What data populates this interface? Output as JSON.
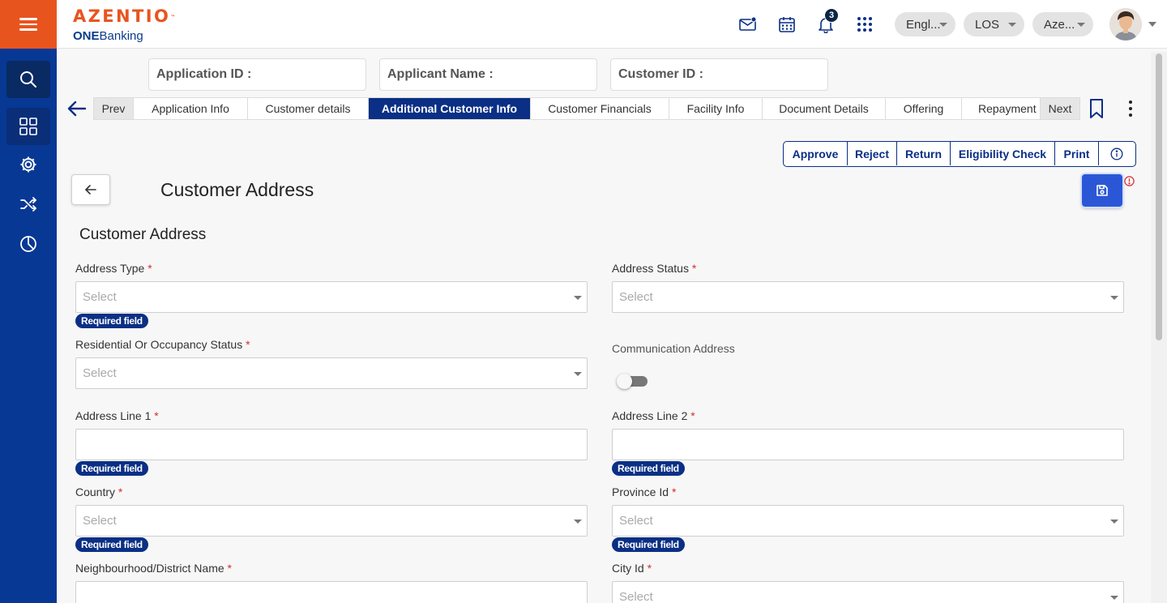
{
  "header": {
    "brand": "AZENTIO",
    "brand_tm": "™",
    "product_bold": "ONE",
    "product_rest": "Banking",
    "notification_count": "3",
    "language": "Engl...",
    "module": "LOS",
    "entity": "Aze...",
    "icons": [
      "mail-icon",
      "calendar-icon",
      "bell-icon",
      "apps-grid-icon"
    ]
  },
  "sidebar": {
    "items": [
      "search-icon",
      "dashboard-icon",
      "settings-gear-icon",
      "shuffle-icon",
      "pie-chart-icon"
    ]
  },
  "info": {
    "application_id_label": "Application ID :",
    "applicant_name_label": "Applicant Name :",
    "customer_id_label": "Customer ID :"
  },
  "tabs": {
    "prev": "Prev",
    "next": "Next",
    "items": [
      "Application Info",
      "Customer details",
      "Additional Customer Info",
      "Customer Financials",
      "Facility Info",
      "Document Details",
      "Offering",
      "Repayment Schedule"
    ],
    "active": "Additional Customer Info"
  },
  "actions": {
    "approve": "Approve",
    "reject": "Reject",
    "return": "Return",
    "eligibility": "Eligibility Check",
    "print": "Print"
  },
  "page": {
    "title": "Customer Address",
    "section_title": "Customer Address"
  },
  "form": {
    "required_msg": "Required field",
    "select_placeholder": "Select",
    "address_type": "Address Type",
    "address_status": "Address Status",
    "residential_status": "Residential Or Occupancy Status",
    "communication_address": "Communication Address",
    "address_line1": "Address Line 1",
    "address_line2": "Address Line 2",
    "country": "Country",
    "province_id": "Province Id",
    "district_name": "Neighbourhood/District Name",
    "city_id": "City Id",
    "required_marker": "*",
    "communication_address_on": false
  },
  "colors": {
    "brand_orange": "#e8541e",
    "sidebar_blue": "#073894",
    "primary_navy": "#0a2f85",
    "save_blue": "#2b57d6",
    "required_red": "#d32f2f"
  }
}
